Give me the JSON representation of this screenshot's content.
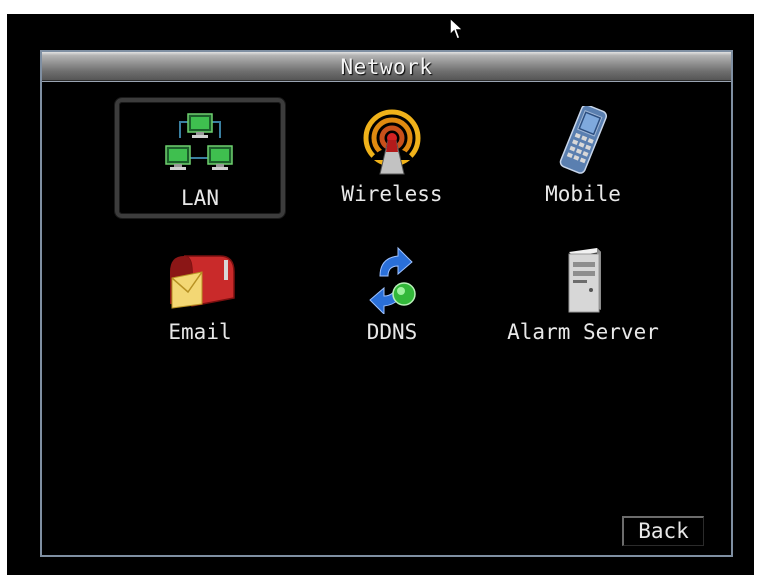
{
  "window": {
    "title": "Network"
  },
  "menu": {
    "items": [
      {
        "label": "LAN",
        "icon": "lan-network-icon",
        "selected": true
      },
      {
        "label": "Wireless",
        "icon": "wireless-antenna-icon",
        "selected": false
      },
      {
        "label": "Mobile",
        "icon": "mobile-phone-icon",
        "selected": false
      },
      {
        "label": "Email",
        "icon": "mailbox-icon",
        "selected": false
      },
      {
        "label": "DDNS",
        "icon": "ddns-arrows-icon",
        "selected": false
      },
      {
        "label": "Alarm Server",
        "icon": "server-tower-icon",
        "selected": false
      }
    ]
  },
  "footer": {
    "back_label": "Back"
  },
  "colors": {
    "panel_border": "#7f8fa2",
    "text": "#e8e8e8",
    "background": "#000000"
  }
}
